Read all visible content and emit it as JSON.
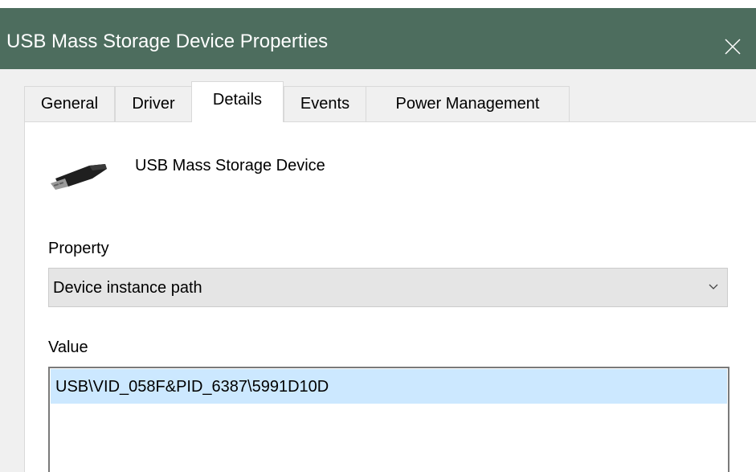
{
  "window": {
    "title": "USB Mass Storage Device Properties",
    "titlebar_color": "#4d6d5e"
  },
  "icons": {
    "close": "close-icon",
    "device": "usb-drive-icon",
    "dropdown": "chevron-down-icon"
  },
  "tabs": [
    {
      "label": "General",
      "active": false
    },
    {
      "label": "Driver",
      "active": false
    },
    {
      "label": "Details",
      "active": true
    },
    {
      "label": "Events",
      "active": false
    },
    {
      "label": "Power Management",
      "active": false
    }
  ],
  "details": {
    "device_name": "USB Mass Storage Device",
    "property_label": "Property",
    "property_selected": "Device instance path",
    "value_label": "Value",
    "values": [
      "USB\\VID_058F&PID_6387\\5991D10D"
    ],
    "selection_color": "#cce8ff"
  }
}
